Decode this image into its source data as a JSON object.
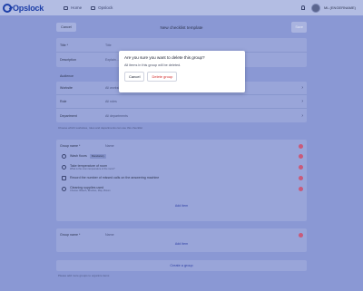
{
  "topbar": {
    "logo_text": "Opslock",
    "nav": [
      {
        "label": "Home",
        "icon": "home-icon"
      },
      {
        "label": "Opslock",
        "icon": "opslock-icon"
      }
    ],
    "user_name": "ML (ENGERNAME)"
  },
  "header": {
    "cancel_label": "Cancel",
    "title": "New checklist template",
    "save_label": "Save"
  },
  "form": {
    "title_label": "Title *",
    "title_placeholder": "Title",
    "description_label": "Description",
    "description_placeholder": "Explain..."
  },
  "audience": {
    "section_label": "Audience",
    "rows": [
      {
        "label": "Worksite",
        "value": "All worksites"
      },
      {
        "label": "Role",
        "value": "All roles"
      },
      {
        "label": "Department",
        "value": "All departments"
      }
    ],
    "hint": "Choose which worksites, roles and departments can use this checklist"
  },
  "groups": [
    {
      "name_label": "Group name *",
      "name_placeholder": "Name",
      "items": [
        {
          "text": "Wash floors",
          "tag": "Mandatory",
          "sub": "",
          "icon": "circle"
        },
        {
          "text": "Take temperature of room",
          "tag": "",
          "sub": "What is the room temperature of the room?",
          "icon": "circle"
        },
        {
          "text": "Record the number of missed calls on the answering machine",
          "tag": "",
          "sub": "",
          "icon": "square"
        },
        {
          "text": "Cleaning supplies used",
          "tag": "",
          "sub": "Choose: Bleach, Brushes, Mop, Broom",
          "icon": "circle"
        }
      ],
      "add_item_label": "Add item"
    },
    {
      "name_label": "Group name *",
      "name_placeholder": "Name",
      "items": [],
      "add_item_label": "Add item"
    }
  ],
  "create_group_label": "Create a group",
  "footer_hint": "Please add more groups to organize items",
  "modal": {
    "title": "Are you sure you want to delete this group?",
    "body": "All items in this group will be deleted.",
    "cancel_label": "Cancel",
    "delete_label": "Delete group"
  },
  "colors": {
    "overlay": "#8a98d4",
    "brand": "#1d3fa8",
    "danger": "#d22c2c",
    "info_dot": "#c95a7a"
  }
}
